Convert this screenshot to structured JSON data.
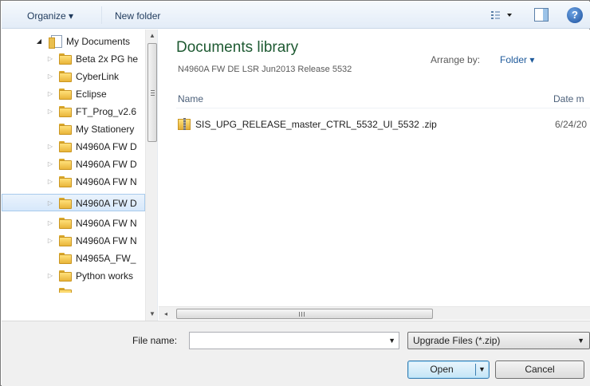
{
  "toolbar": {
    "organize_label": "Organize ▾",
    "new_folder_label": "New folder",
    "views_icon": "views-icon",
    "preview_icon": "preview-pane-icon",
    "help_glyph": "?"
  },
  "nav": {
    "items": [
      {
        "label": "My Documents",
        "icon": "documents-library-icon",
        "arrow": "◢",
        "expanded": true
      },
      {
        "label": "Beta 2x PG he",
        "icon": "folder-icon",
        "arrow": "▷"
      },
      {
        "label": "CyberLink",
        "icon": "folder-icon",
        "arrow": "▷"
      },
      {
        "label": "Eclipse",
        "icon": "folder-icon",
        "arrow": "▷"
      },
      {
        "label": "FT_Prog_v2.6",
        "icon": "folder-icon",
        "arrow": "▷"
      },
      {
        "label": "My Stationery",
        "icon": "folder-icon",
        "arrow": ""
      },
      {
        "label": "N4960A FW D",
        "icon": "folder-icon",
        "arrow": "▷"
      },
      {
        "label": "N4960A FW D",
        "icon": "folder-icon",
        "arrow": "▷"
      },
      {
        "label": "N4960A FW D",
        "icon": "folder-icon",
        "arrow": "▷",
        "selected": true
      },
      {
        "label": "N4960A FW N",
        "icon": "folder-icon",
        "arrow": "▷"
      },
      {
        "label": "N4960A FW N",
        "icon": "folder-icon",
        "arrow": "▷"
      },
      {
        "label": "N4960A FW N",
        "icon": "folder-icon",
        "arrow": "▷"
      },
      {
        "label": "N4965A_FW_",
        "icon": "folder-icon",
        "arrow": ""
      },
      {
        "label": "Python works",
        "icon": "folder-icon",
        "arrow": "▷"
      }
    ]
  },
  "main": {
    "library_title": "Documents library",
    "library_subtitle": "N4960A FW DE LSR Jun2013 Release 5532",
    "arrange_by_label": "Arrange by:",
    "arrange_by_value": "Folder ▾",
    "columns": {
      "name": "Name",
      "date": "Date m"
    },
    "files": [
      {
        "name": "SIS_UPG_RELEASE_master_CTRL_5532_UI_5532 .zip",
        "date": "6/24/20",
        "icon": "zip-folder-icon"
      }
    ]
  },
  "hscroll": {
    "left_arrow": "◂",
    "grip": "III"
  },
  "bottom": {
    "file_name_label": "File name:",
    "file_name_value": "",
    "file_type_value": "Upgrade Files (*.zip)",
    "open_label": "Open",
    "cancel_label": "Cancel"
  }
}
